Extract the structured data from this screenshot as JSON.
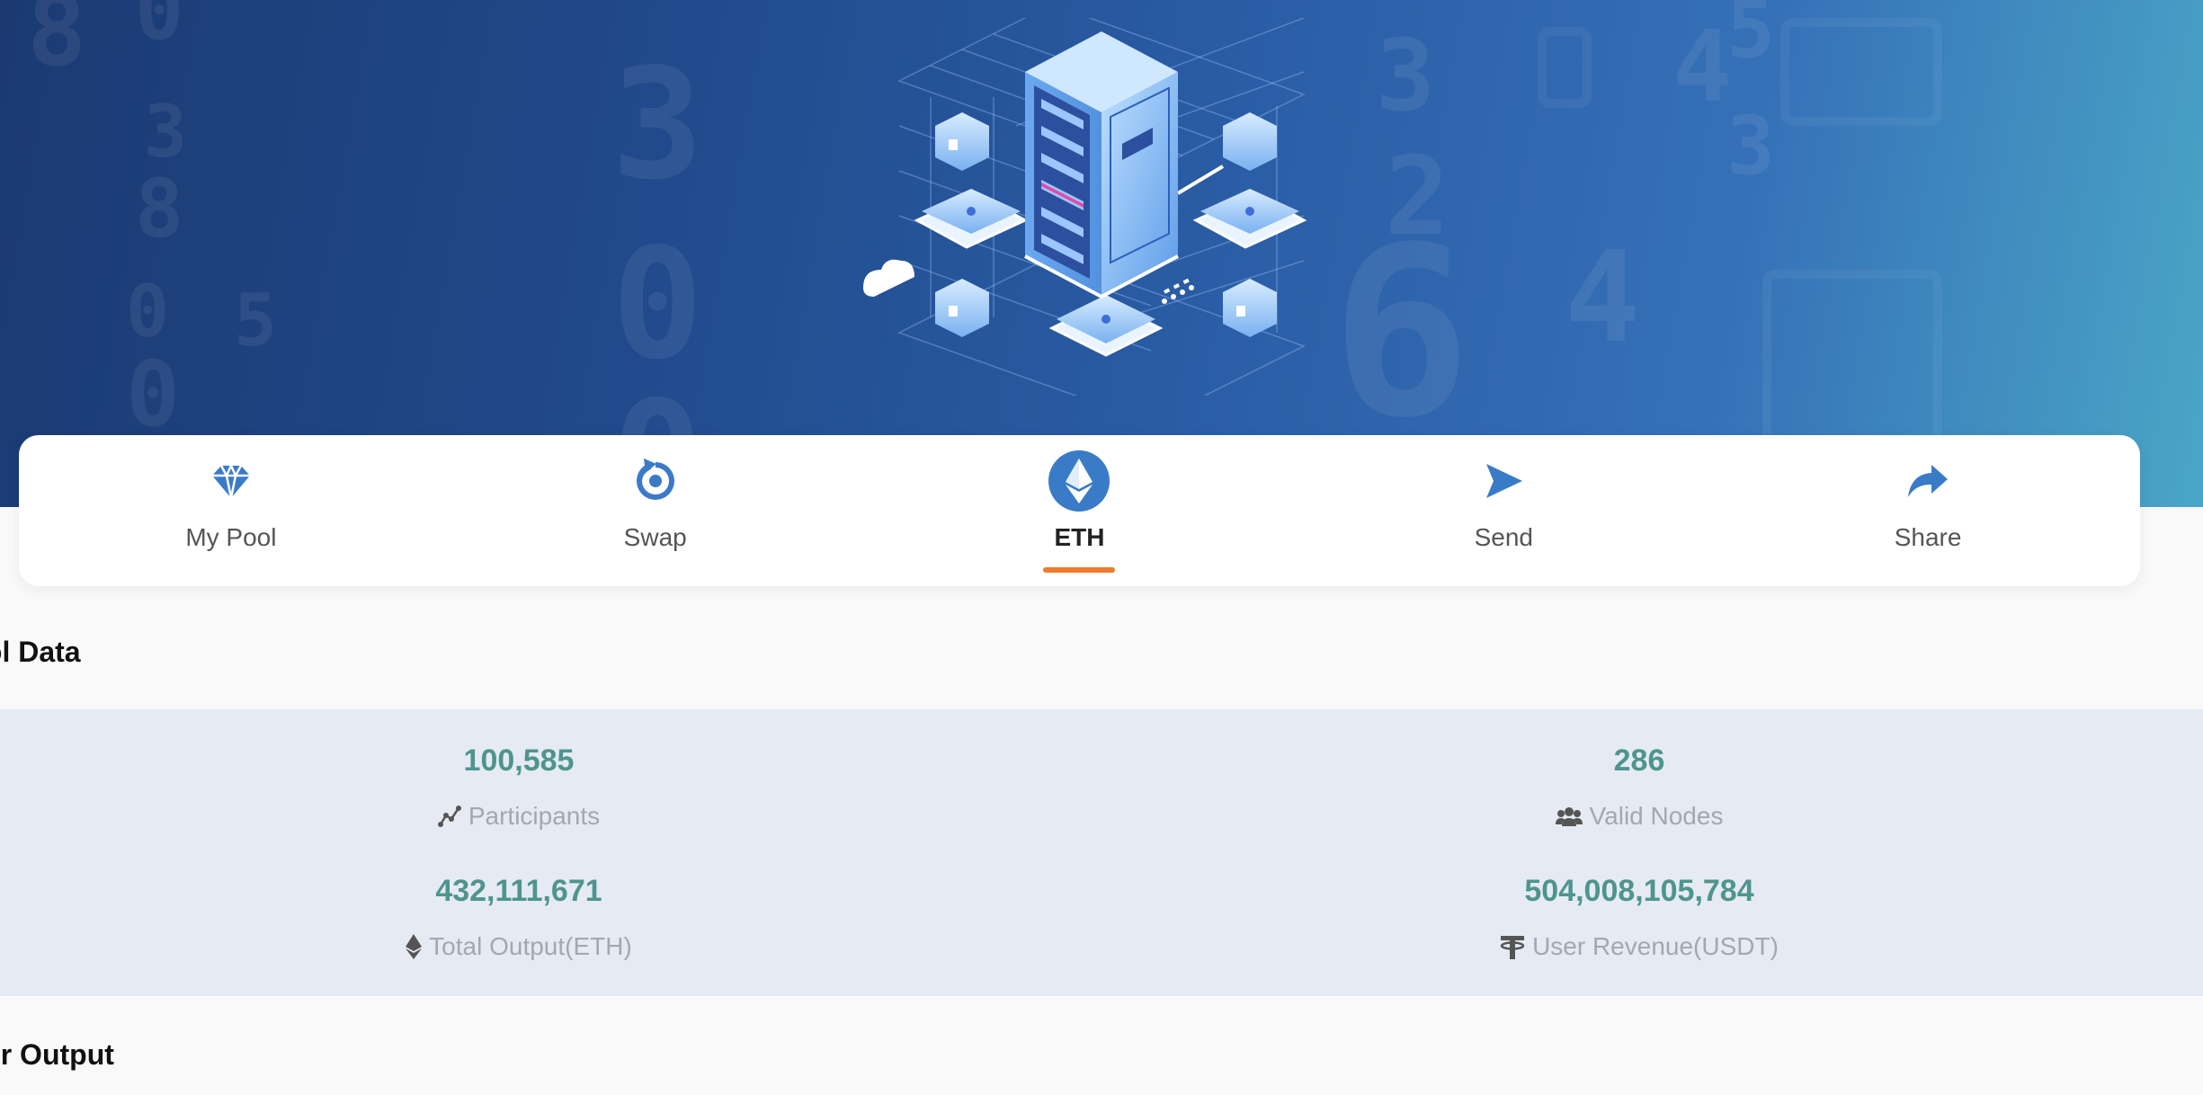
{
  "nav": {
    "items": [
      {
        "label": "My Pool",
        "icon": "diamond-icon"
      },
      {
        "label": "Swap",
        "icon": "refresh-icon"
      },
      {
        "label": "ETH",
        "icon": "ethereum-icon",
        "active": true
      },
      {
        "label": "Send",
        "icon": "send-icon"
      },
      {
        "label": "Share",
        "icon": "share-icon"
      }
    ]
  },
  "pool": {
    "title": "Pool Data",
    "stats": [
      {
        "value": "100,585",
        "label": "Participants",
        "icon": "chart-line-icon"
      },
      {
        "value": "286",
        "label": "Valid Nodes",
        "icon": "users-icon"
      },
      {
        "value": "432,111,671",
        "label": "Total Output(ETH)",
        "icon": "ethereum-small-icon"
      },
      {
        "value": "504,008,105,784",
        "label": "User Revenue(USDT)",
        "icon": "tether-icon"
      }
    ]
  },
  "output": {
    "title": "User Output"
  },
  "colors": {
    "accent": "#3a7bc8",
    "stat_value": "#4e958d",
    "active_underline": "#ef7b2c",
    "stats_bg": "#e6ebf3"
  }
}
